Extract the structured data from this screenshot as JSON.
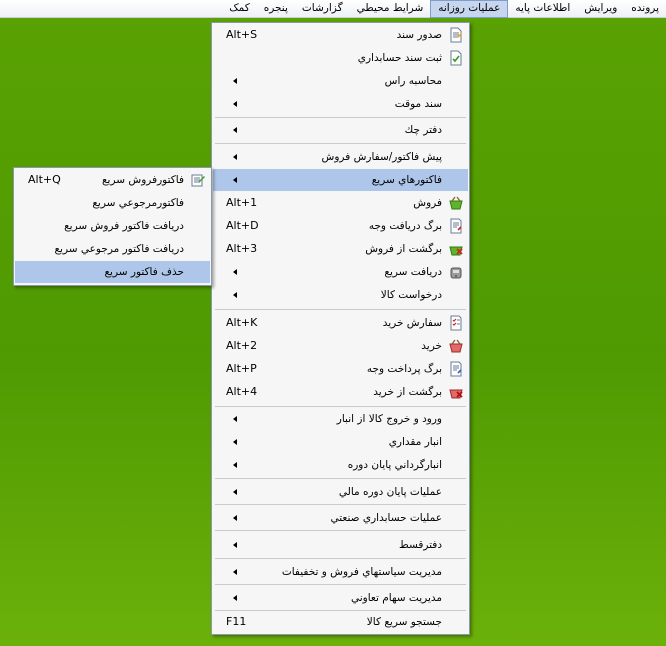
{
  "menubar": {
    "items": [
      {
        "label": "پرونده"
      },
      {
        "label": "ويرايش"
      },
      {
        "label": "اطلاعات پايه"
      },
      {
        "label": "عمليات روزانه",
        "active": true
      },
      {
        "label": "شرايط محيطي"
      },
      {
        "label": "گزارشات"
      },
      {
        "label": "پنجره"
      },
      {
        "label": "کمک"
      }
    ]
  },
  "main_menu": {
    "items": [
      {
        "label": "صدور سند",
        "shortcut": "Alt+S",
        "icon": "document-issue-icon"
      },
      {
        "label": "ثبت سند حسابداري",
        "icon": "document-check-icon"
      },
      {
        "label": "محاسبه راس",
        "submenu": true
      },
      {
        "label": "سند موقت",
        "submenu": true
      },
      {
        "label": "دفتر چك",
        "submenu": true
      },
      {
        "label": "پيش فاكتور/سفارش فروش",
        "submenu": true
      },
      {
        "label": "فاكتورهاي سريع",
        "submenu": true,
        "highlight": true
      },
      {
        "label": "فروش",
        "shortcut": "Alt+1",
        "icon": "sales-basket-icon"
      },
      {
        "label": "برگ دريافت وجه",
        "shortcut": "Alt+D",
        "icon": "receipt-icon"
      },
      {
        "label": "برگشت از فروش",
        "shortcut": "Alt+3",
        "icon": "sales-return-icon"
      },
      {
        "label": "دريافت سريع",
        "submenu": true,
        "icon": "cash-register-icon"
      },
      {
        "label": "درخواست كالا",
        "submenu": true
      },
      {
        "label": "سفارش خريد",
        "shortcut": "Alt+K",
        "icon": "purchase-order-icon"
      },
      {
        "label": "خريد",
        "shortcut": "Alt+2",
        "icon": "purchase-basket-icon"
      },
      {
        "label": "برگ پرداخت وجه",
        "shortcut": "Alt+P",
        "icon": "payment-icon"
      },
      {
        "label": "برگشت از خريد",
        "shortcut": "Alt+4",
        "icon": "purchase-return-icon"
      },
      {
        "label": "ورود و خروج كالا از انبار",
        "submenu": true
      },
      {
        "label": "انبار مقداري",
        "submenu": true
      },
      {
        "label": "انبارگرداني پايان دوره",
        "submenu": true
      },
      {
        "label": "عمليات پايان دوره مالي",
        "submenu": true
      },
      {
        "label": "عمليات حسابداري صنعتي",
        "submenu": true
      },
      {
        "label": "دفترقسط",
        "submenu": true
      },
      {
        "label": "مديريت سياستهاي فروش و تخفيفات",
        "submenu": true
      },
      {
        "label": "مديريت سهام تعاوني",
        "submenu": true
      },
      {
        "label": "جستجو سريع كالا",
        "shortcut": "F11"
      }
    ]
  },
  "sub_menu": {
    "items": [
      {
        "label": "فاكتورفروش سريع",
        "shortcut": "Alt+Q",
        "icon": "quick-invoice-icon"
      },
      {
        "label": "فاكتورمرجوعي سريع"
      },
      {
        "label": "دريافت فاكتور فروش سريع"
      },
      {
        "label": "دريافت فاكتور مرجوعي سريع"
      },
      {
        "label": "حذف فاكتور سريع",
        "highlight": true
      }
    ]
  }
}
